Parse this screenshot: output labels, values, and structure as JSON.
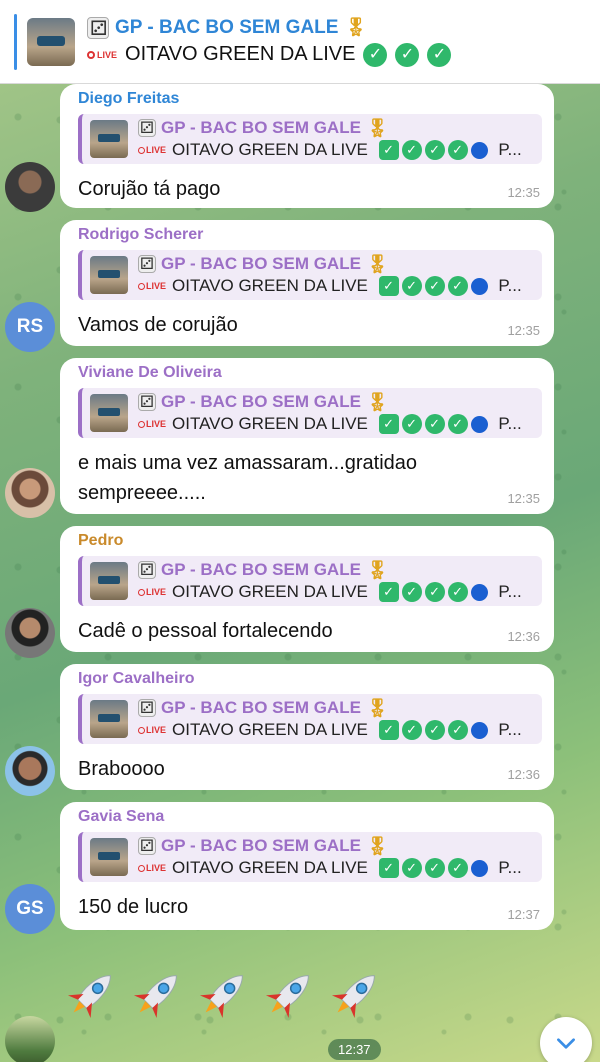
{
  "pinned": {
    "title": "GP - BAC BO SEM GALE",
    "subtitle": "OITAVO GREEN DA LIVE",
    "live_label": "LIVE"
  },
  "quote": {
    "title": "GP - BAC BO SEM GALE",
    "body": "OITAVO GREEN DA LIVE",
    "live_label": "LIVE",
    "ellipsis": "P..."
  },
  "messages": [
    {
      "sender": "Diego Freitas",
      "sender_color": "#2f86d6",
      "text": "Corujão tá pago",
      "time": "12:35"
    },
    {
      "sender": "Rodrigo Scherer",
      "sender_color": "#9c6fc6",
      "text": "Vamos de corujão",
      "time": "12:35",
      "avatar_initials": "RS"
    },
    {
      "sender": "Viviane De Oliveira",
      "sender_color": "#9c6fc6",
      "text": "e mais uma vez amassaram...gratidao sempreeee.....",
      "time": "12:35"
    },
    {
      "sender": "Pedro",
      "sender_color": "#c98a2b",
      "text": "Cadê o pessoal fortalecendo",
      "time": "12:36"
    },
    {
      "sender": "Igor Cavalheiro",
      "sender_color": "#9c6fc6",
      "text": "Braboooo",
      "time": "12:36"
    },
    {
      "sender": "Gavia Sena",
      "sender_color": "#9c6fc6",
      "text": "150 de lucro",
      "time": "12:37",
      "avatar_initials": "GS"
    }
  ],
  "last_message": {
    "content": "rocket-emoji x5",
    "time": "12:37"
  }
}
